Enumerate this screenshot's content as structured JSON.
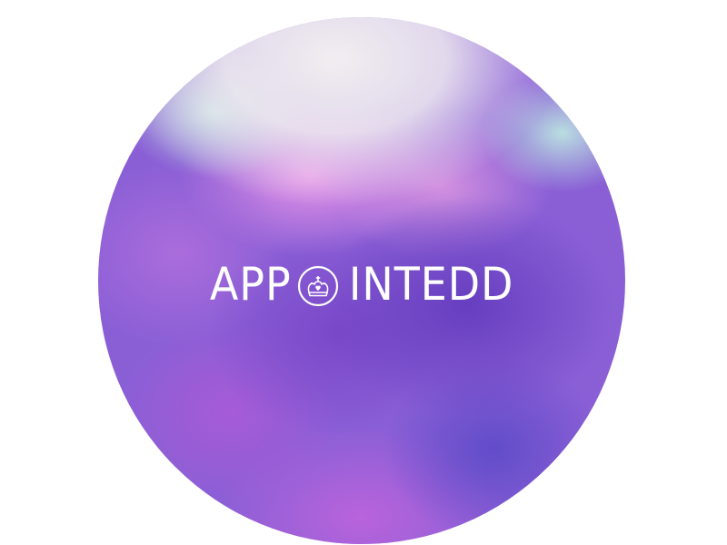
{
  "logo": {
    "text_before": "APP",
    "text_after": "INTEDD",
    "emblem_icon": "crown-in-circle-icon"
  },
  "colors": {
    "background": "#ffffff",
    "orb_base": "#8a5fd6",
    "logo_text": "#ffffff"
  }
}
